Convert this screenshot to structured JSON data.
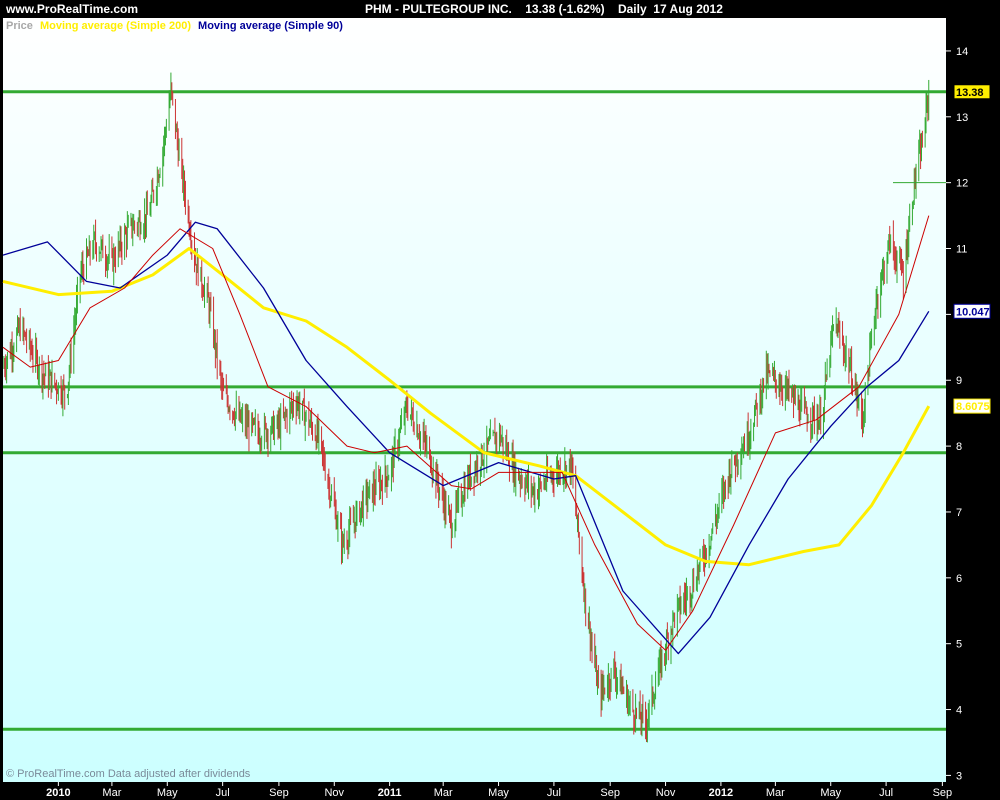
{
  "header": {
    "site": "www.ProRealTime.com",
    "title": "PHM - PULTEGROUP INC.    13.38 (-1.62%)    Daily  17 Aug 2012"
  },
  "legend": {
    "price": "Price",
    "ma200": "Moving average (Simple 200)",
    "ma90": "Moving average (Simple 90)"
  },
  "footer": {
    "note": "© ProRealTime.com  Data adjusted after dividends"
  },
  "colors": {
    "background_top": "#ffffff",
    "background_bottom": "#ccffff",
    "up_candle": "#33aa33",
    "down_candle": "#cc3333",
    "ma200": "#ffee00",
    "ma90": "#000099",
    "price_line": "#cc0000",
    "hlines": "#33aa33"
  },
  "chart_data": {
    "type": "line",
    "y_range": [
      2.9,
      14.5
    ],
    "y_ticks": [
      3,
      4,
      5,
      6,
      7,
      8,
      9,
      10,
      11,
      12,
      13,
      14
    ],
    "x_labels": [
      "2010",
      "Mar",
      "May",
      "Jul",
      "Sep",
      "Nov",
      "2011",
      "Mar",
      "May",
      "Jul",
      "Sep",
      "Nov",
      "2012",
      "Mar",
      "May",
      "Jul",
      "Sep"
    ],
    "x_label_dates": [
      "2010-01-01",
      "2010-03-01",
      "2010-05-01",
      "2010-07-01",
      "2010-09-01",
      "2010-11-01",
      "2011-01-01",
      "2011-03-01",
      "2011-05-01",
      "2011-07-01",
      "2011-09-01",
      "2011-11-01",
      "2012-01-01",
      "2012-03-01",
      "2012-05-01",
      "2012-07-01",
      "2012-09-01"
    ],
    "x_range": [
      "2009-11-01",
      "2012-09-05"
    ],
    "horizontal_levels": [
      13.38,
      8.9,
      7.9,
      3.7
    ],
    "last_values": {
      "price": "13.38",
      "ma90": "10.047",
      "ma200": "8.6075"
    },
    "grid": false,
    "legend_position": "top-left",
    "series": [
      {
        "name": "Price",
        "points": [
          [
            "2009-11-01",
            9.2
          ],
          [
            "2009-11-20",
            9.8
          ],
          [
            "2009-12-15",
            9.1
          ],
          [
            "2010-01-10",
            8.8
          ],
          [
            "2010-01-25",
            10.6
          ],
          [
            "2010-02-10",
            11.1
          ],
          [
            "2010-03-01",
            10.8
          ],
          [
            "2010-03-20",
            11.3
          ],
          [
            "2010-04-10",
            11.5
          ],
          [
            "2010-04-25",
            12.4
          ],
          [
            "2010-05-05",
            13.4
          ],
          [
            "2010-05-15",
            12.3
          ],
          [
            "2010-06-01",
            10.8
          ],
          [
            "2010-06-15",
            10.2
          ],
          [
            "2010-07-01",
            8.8
          ],
          [
            "2010-07-20",
            8.4
          ],
          [
            "2010-08-10",
            8.2
          ],
          [
            "2010-09-01",
            8.3
          ],
          [
            "2010-09-20",
            8.7
          ],
          [
            "2010-10-15",
            8.1
          ],
          [
            "2010-11-10",
            6.5
          ],
          [
            "2010-12-05",
            7.2
          ],
          [
            "2011-01-01",
            7.6
          ],
          [
            "2011-01-20",
            8.6
          ],
          [
            "2011-02-10",
            8.0
          ],
          [
            "2011-03-10",
            6.8
          ],
          [
            "2011-03-25",
            7.4
          ],
          [
            "2011-04-10",
            7.8
          ],
          [
            "2011-05-01",
            8.2
          ],
          [
            "2011-05-20",
            7.6
          ],
          [
            "2011-06-10",
            7.3
          ],
          [
            "2011-07-01",
            7.6
          ],
          [
            "2011-07-20",
            7.7
          ],
          [
            "2011-08-05",
            5.6
          ],
          [
            "2011-08-20",
            4.2
          ],
          [
            "2011-09-05",
            4.6
          ],
          [
            "2011-09-25",
            4.0
          ],
          [
            "2011-10-10",
            3.8
          ],
          [
            "2011-10-25",
            4.6
          ],
          [
            "2011-11-10",
            5.4
          ],
          [
            "2011-12-01",
            5.9
          ],
          [
            "2011-12-20",
            6.6
          ],
          [
            "2012-01-10",
            7.6
          ],
          [
            "2012-02-01",
            8.2
          ],
          [
            "2012-02-20",
            9.1
          ],
          [
            "2012-03-10",
            8.9
          ],
          [
            "2012-04-01",
            8.5
          ],
          [
            "2012-04-20",
            8.4
          ],
          [
            "2012-05-05",
            9.9
          ],
          [
            "2012-05-20",
            9.3
          ],
          [
            "2012-06-05",
            8.4
          ],
          [
            "2012-06-20",
            10.2
          ],
          [
            "2012-07-05",
            11.1
          ],
          [
            "2012-07-20",
            10.6
          ],
          [
            "2012-08-01",
            12.0
          ],
          [
            "2012-08-10",
            12.6
          ],
          [
            "2012-08-17",
            13.38
          ]
        ]
      },
      {
        "name": "Moving average (Simple 200)",
        "points": [
          [
            "2009-11-01",
            10.5
          ],
          [
            "2010-01-01",
            10.3
          ],
          [
            "2010-03-01",
            10.35
          ],
          [
            "2010-04-15",
            10.6
          ],
          [
            "2010-05-25",
            11.0
          ],
          [
            "2010-07-01",
            10.6
          ],
          [
            "2010-08-15",
            10.1
          ],
          [
            "2010-10-01",
            9.9
          ],
          [
            "2010-11-15",
            9.5
          ],
          [
            "2011-01-01",
            9.0
          ],
          [
            "2011-02-15",
            8.5
          ],
          [
            "2011-04-15",
            7.9
          ],
          [
            "2011-06-15",
            7.7
          ],
          [
            "2011-07-25",
            7.55
          ],
          [
            "2011-09-15",
            7.0
          ],
          [
            "2011-11-01",
            6.5
          ],
          [
            "2011-12-15",
            6.25
          ],
          [
            "2012-02-01",
            6.2
          ],
          [
            "2012-04-01",
            6.4
          ],
          [
            "2012-05-10",
            6.5
          ],
          [
            "2012-06-15",
            7.1
          ],
          [
            "2012-07-20",
            7.9
          ],
          [
            "2012-08-17",
            8.6075
          ]
        ]
      },
      {
        "name": "Moving average (Simple 90)",
        "points": [
          [
            "2009-11-01",
            10.9
          ],
          [
            "2009-12-20",
            11.1
          ],
          [
            "2010-02-01",
            10.5
          ],
          [
            "2010-03-10",
            10.4
          ],
          [
            "2010-05-01",
            10.9
          ],
          [
            "2010-06-01",
            11.4
          ],
          [
            "2010-06-25",
            11.3
          ],
          [
            "2010-08-15",
            10.4
          ],
          [
            "2010-10-01",
            9.3
          ],
          [
            "2010-11-15",
            8.6
          ],
          [
            "2011-01-01",
            7.9
          ],
          [
            "2011-03-01",
            7.4
          ],
          [
            "2011-05-01",
            7.75
          ],
          [
            "2011-07-01",
            7.5
          ],
          [
            "2011-07-25",
            7.55
          ],
          [
            "2011-09-15",
            5.8
          ],
          [
            "2011-11-15",
            4.85
          ],
          [
            "2011-12-20",
            5.4
          ],
          [
            "2012-02-01",
            6.5
          ],
          [
            "2012-03-15",
            7.5
          ],
          [
            "2012-05-01",
            8.3
          ],
          [
            "2012-06-10",
            8.9
          ],
          [
            "2012-07-15",
            9.3
          ],
          [
            "2012-08-17",
            10.047
          ]
        ]
      },
      {
        "name": "Price smoothed",
        "points": [
          [
            "2009-11-01",
            9.5
          ],
          [
            "2009-12-01",
            9.2
          ],
          [
            "2010-01-01",
            9.3
          ],
          [
            "2010-02-05",
            10.1
          ],
          [
            "2010-03-15",
            10.4
          ],
          [
            "2010-04-15",
            10.9
          ],
          [
            "2010-05-15",
            11.3
          ],
          [
            "2010-06-20",
            11.0
          ],
          [
            "2010-07-20",
            10.0
          ],
          [
            "2010-08-20",
            8.9
          ],
          [
            "2010-10-01",
            8.6
          ],
          [
            "2010-11-15",
            8.0
          ],
          [
            "2010-12-15",
            7.9
          ],
          [
            "2011-01-20",
            8.0
          ],
          [
            "2011-03-10",
            7.4
          ],
          [
            "2011-04-01",
            7.35
          ],
          [
            "2011-05-01",
            7.6
          ],
          [
            "2011-06-01",
            7.6
          ],
          [
            "2011-07-10",
            7.6
          ],
          [
            "2011-08-15",
            6.5
          ],
          [
            "2011-10-01",
            5.3
          ],
          [
            "2011-11-01",
            4.9
          ],
          [
            "2011-12-01",
            5.5
          ],
          [
            "2012-01-15",
            6.8
          ],
          [
            "2012-03-01",
            8.2
          ],
          [
            "2012-04-15",
            8.4
          ],
          [
            "2012-06-01",
            8.9
          ],
          [
            "2012-07-15",
            10.0
          ],
          [
            "2012-08-17",
            11.5
          ]
        ]
      }
    ]
  }
}
